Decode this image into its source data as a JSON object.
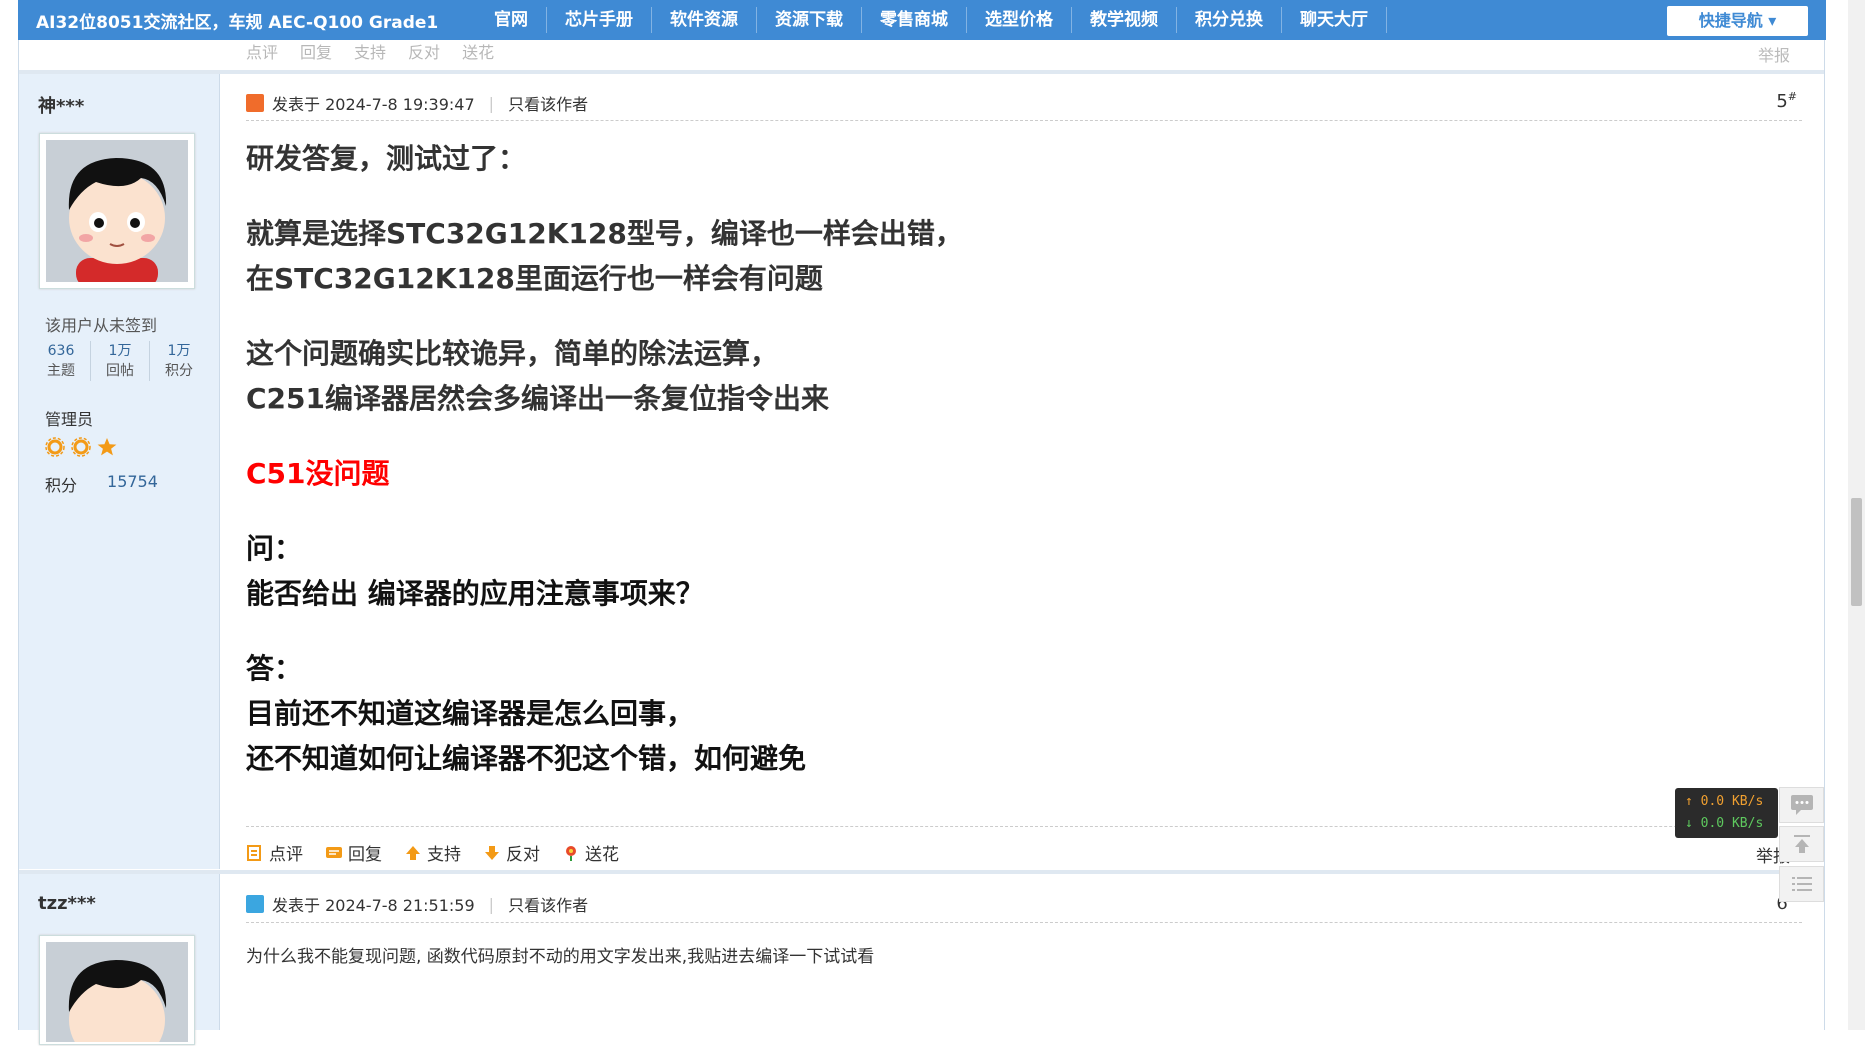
{
  "nav": {
    "brand": "AI32位8051交流社区，车规 AEC-Q100 Grade1",
    "items": [
      "官网",
      "芯片手册",
      "软件资源",
      "资源下载",
      "零售商城",
      "选型价格",
      "教学视频",
      "积分兑换",
      "聊天大厅"
    ],
    "quick_nav": "快捷导航 ▾"
  },
  "actions": {
    "comment": "点评",
    "reply": "回复",
    "support": "支持",
    "oppose": "反对",
    "flower": "送花",
    "report": "举报"
  },
  "posts": [
    {
      "author": "神***",
      "sign_status": "该用户从未签到",
      "stats": [
        {
          "value": "636",
          "label": "主题"
        },
        {
          "value": "1万",
          "label": "回帖"
        },
        {
          "value": "1万",
          "label": "积分"
        }
      ],
      "role": "管理员",
      "points_label": "积分",
      "points_value": "15754",
      "posted": "发表于 2024-7-8 19:39:47",
      "author_only": "只看该作者",
      "floor": "5",
      "floor_suffix": "#",
      "content": {
        "l1": "研发答复，测试过了：",
        "l2": "就算是选择STC32G12K128型号，编译也一样会出错，",
        "l3": "在STC32G12K128里面运行也一样会有问题",
        "l4": "这个问题确实比较诡异，简单的除法运算，",
        "l5": "C251编译器居然会多编译出一条复位指令出来",
        "l6": "C51没问题",
        "l7": "问：",
        "l8": "能否给出 编译器的应用注意事项来？",
        "l9": "答：",
        "l10": "目前还不知道这编译器是怎么回事，",
        "l11": "还不知道如何让编译器不犯这个错，如何避免"
      }
    },
    {
      "author": "tzz***",
      "posted": "发表于 2024-7-8 21:51:59",
      "author_only": "只看该作者",
      "floor": "6",
      "floor_suffix": "#",
      "content": "为什么我不能复现问题, 函数代码原封不动的用文字发出来,我贴进去编译一下试试看"
    }
  ],
  "netspeed": {
    "up": "↑ 0.0 KB/s",
    "down": "↓ 0.0 KB/s"
  },
  "colors": {
    "nav_bg": "#3f8ad4",
    "sidebar_bg": "#e6f0fa",
    "red": "#ff0000",
    "link": "#336699"
  }
}
